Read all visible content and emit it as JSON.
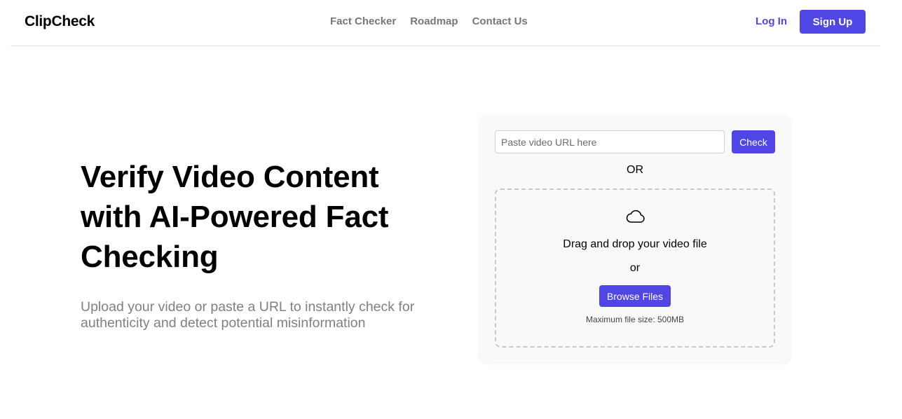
{
  "brand": {
    "name": "ClipCheck",
    "accent": "#4f46e5"
  },
  "nav": {
    "links": [
      "Fact Checker",
      "Roadmap",
      "Contact Us"
    ],
    "login_label": "Log In",
    "signup_label": "Sign Up"
  },
  "hero": {
    "title": "Verify Video Content with AI-Powered Fact Checking",
    "subtitle": "Upload your video or paste a URL to instantly check for authenticity and detect potential misinformation"
  },
  "upload": {
    "url_placeholder": "Paste video URL here",
    "url_value": "",
    "check_label": "Check",
    "or_label": "OR",
    "cloud_icon": "cloud-icon",
    "drag_text": "Drag and drop your video file",
    "or_inner_label": "or",
    "browse_label": "Browse Files",
    "max_size_text": "Maximum file size: 500MB"
  }
}
